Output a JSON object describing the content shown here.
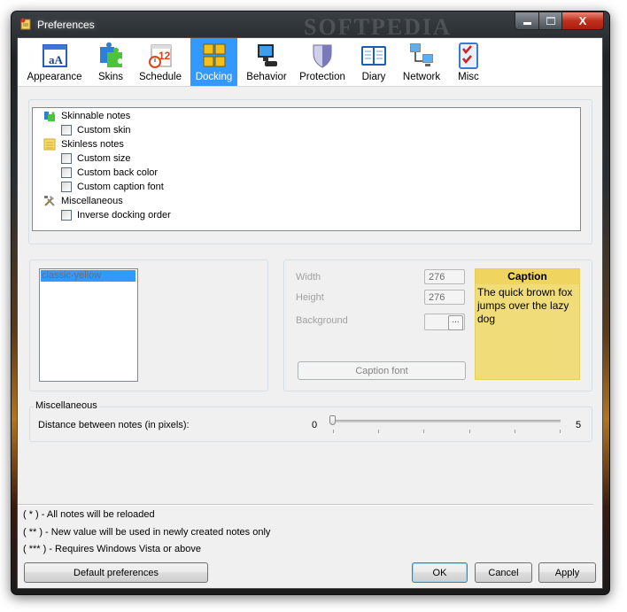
{
  "window": {
    "title": "Preferences",
    "watermark": "SOFTPEDIA",
    "controls": {
      "minimize": "—",
      "maximize": "□",
      "close": "X"
    }
  },
  "tabs": [
    {
      "id": "appearance",
      "label": "Appearance",
      "icon": "appearance-icon",
      "active": false
    },
    {
      "id": "skins",
      "label": "Skins",
      "icon": "puzzle-icon",
      "active": false
    },
    {
      "id": "schedule",
      "label": "Schedule",
      "icon": "calendar-alarm-icon",
      "active": false
    },
    {
      "id": "docking",
      "label": "Docking",
      "icon": "docking-grid-icon",
      "active": true
    },
    {
      "id": "behavior",
      "label": "Behavior",
      "icon": "computer-icon",
      "active": false
    },
    {
      "id": "protection",
      "label": "Protection",
      "icon": "shield-icon",
      "active": false
    },
    {
      "id": "diary",
      "label": "Diary",
      "icon": "book-icon",
      "active": false
    },
    {
      "id": "network",
      "label": "Network",
      "icon": "network-icon",
      "active": false
    },
    {
      "id": "misc",
      "label": "Misc",
      "icon": "checklist-icon",
      "active": false
    }
  ],
  "tree": {
    "groups": [
      {
        "label": "Skinnable notes",
        "icon": "puzzle-icon",
        "items": [
          {
            "label": "Custom skin",
            "checked": false
          }
        ]
      },
      {
        "label": "Skinless notes",
        "icon": "note-icon",
        "items": [
          {
            "label": "Custom size",
            "checked": false
          },
          {
            "label": "Custom back color",
            "checked": false
          },
          {
            "label": "Custom caption font",
            "checked": false
          }
        ]
      },
      {
        "label": "Miscellaneous",
        "icon": "tools-icon",
        "items": [
          {
            "label": "Inverse docking order",
            "checked": false
          }
        ]
      }
    ]
  },
  "skin_list": {
    "items": [
      "classic-yellow"
    ],
    "selected": "classic-yellow"
  },
  "note_settings": {
    "width_label": "Width",
    "width_value": "276",
    "height_label": "Height",
    "height_value": "276",
    "background_label": "Background",
    "background_button": "...",
    "caption_font_button": "Caption font"
  },
  "preview": {
    "caption": "Caption",
    "body": "The quick brown fox jumps over the lazy dog",
    "color": "#f0dc78",
    "caption_color": "#f0d460"
  },
  "misc_group": {
    "title": "Miscellaneous",
    "distance_label": "Distance between notes (in pixels):",
    "min_label": "0",
    "max_label": "5",
    "value": 0,
    "min": 0,
    "max": 5
  },
  "footnotes": [
    "( * ) - All notes will be reloaded",
    "( ** ) - New value will be used in newly created notes only",
    "( *** ) - Requires Windows Vista or above"
  ],
  "buttons": {
    "default_prefs": "Default preferences",
    "ok": "OK",
    "cancel": "Cancel",
    "apply": "Apply"
  },
  "colors": {
    "accent": "#3399ff",
    "dialog_bg": "#f0f0f0"
  }
}
